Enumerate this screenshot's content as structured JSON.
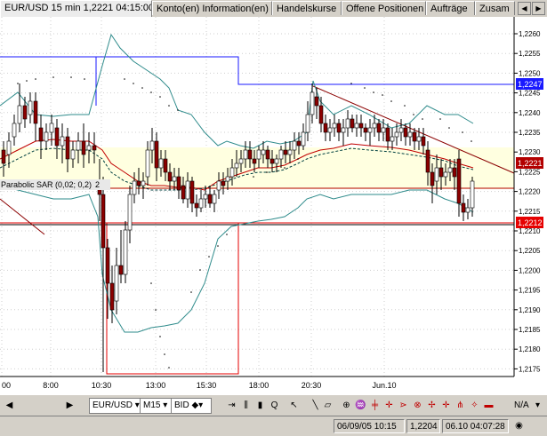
{
  "tabs": [
    {
      "label": "EUR/USD 15 min 1,2221 04:15:00",
      "active": true
    },
    {
      "label": "Konto(en) Information(en)",
      "active": false
    },
    {
      "label": "Handelskurse",
      "active": false
    },
    {
      "label": "Offene Positionen",
      "active": false
    },
    {
      "label": "Aufträge",
      "active": false
    },
    {
      "label": "Zusam",
      "active": false
    }
  ],
  "chart": {
    "indicator_label": "Parabolic SAR (0,02; 0,2)",
    "indicator_num": "2",
    "price_scale": [
      "1,2260",
      "1,2255",
      "1,2250",
      "1,2245",
      "1,2240",
      "1,2235",
      "1,2230",
      "1,2225",
      "1,2220",
      "1,2215",
      "1,2210",
      "1,2205",
      "1,2200",
      "1,2195",
      "1,2190",
      "1,2185",
      "1,2180",
      "1,2175"
    ],
    "price_tags": [
      {
        "value": "1,2247",
        "color": "#1a1aff"
      },
      {
        "value": "1,2221",
        "color": "#b30000"
      },
      {
        "value": "1,2212",
        "color": "#e60000"
      }
    ],
    "time_labels": [
      "00",
      "8:00",
      "10:30",
      "13:00",
      "15:30",
      "18:00",
      "20:30",
      "Jun.10"
    ]
  },
  "toolbar": {
    "symbol": "EUR/USD",
    "timeframe": "M15",
    "price_type": "BID",
    "na_label": "N/A"
  },
  "status": {
    "datetime": "06/09/05 10:15",
    "price": "1,2204",
    "current": "06.10 04:07:28"
  },
  "colors": {
    "up": "#ffffff",
    "down": "#8b0000",
    "bollinger": "#2e8b8b",
    "ma_red": "#c00000",
    "ma_dark": "#004040",
    "blue": "#1a1aff",
    "red": "#e60000"
  }
}
